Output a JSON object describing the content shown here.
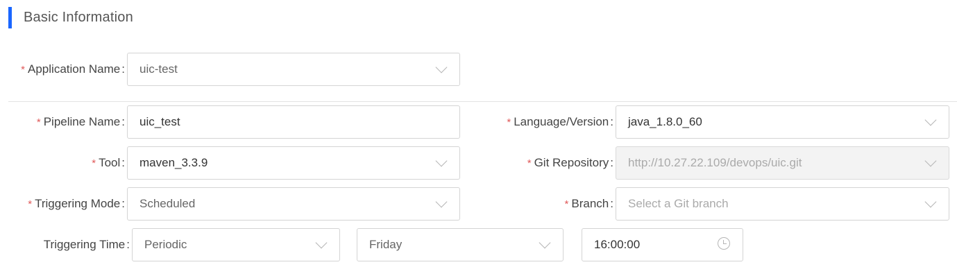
{
  "section": {
    "title": "Basic Information",
    "accent_color": "#1a66ff"
  },
  "application": {
    "label": "Application Name",
    "value": "uic-test",
    "required": true
  },
  "pipeline": {
    "label": "Pipeline Name",
    "value": "uic_test",
    "required": true
  },
  "language": {
    "label": "Language/Version",
    "value": "java_1.8.0_60",
    "required": true
  },
  "tool": {
    "label": "Tool",
    "value": "maven_3.3.9",
    "required": true
  },
  "git_repository": {
    "label": "Git Repository",
    "value": "http://10.27.22.109/devops/uic.git",
    "required": true,
    "disabled": true
  },
  "triggering_mode": {
    "label": "Triggering Mode",
    "value": "Scheduled",
    "required": true
  },
  "branch": {
    "label": "Branch",
    "placeholder": "Select a Git branch",
    "required": true
  },
  "triggering_time": {
    "label": "Triggering Time",
    "frequency": "Periodic",
    "day": "Friday",
    "time": "16:00:00"
  },
  "required_mark": "*",
  "colon": ":",
  "icons": {
    "dropdown": "chevron-down-icon",
    "time": "clock-icon"
  }
}
